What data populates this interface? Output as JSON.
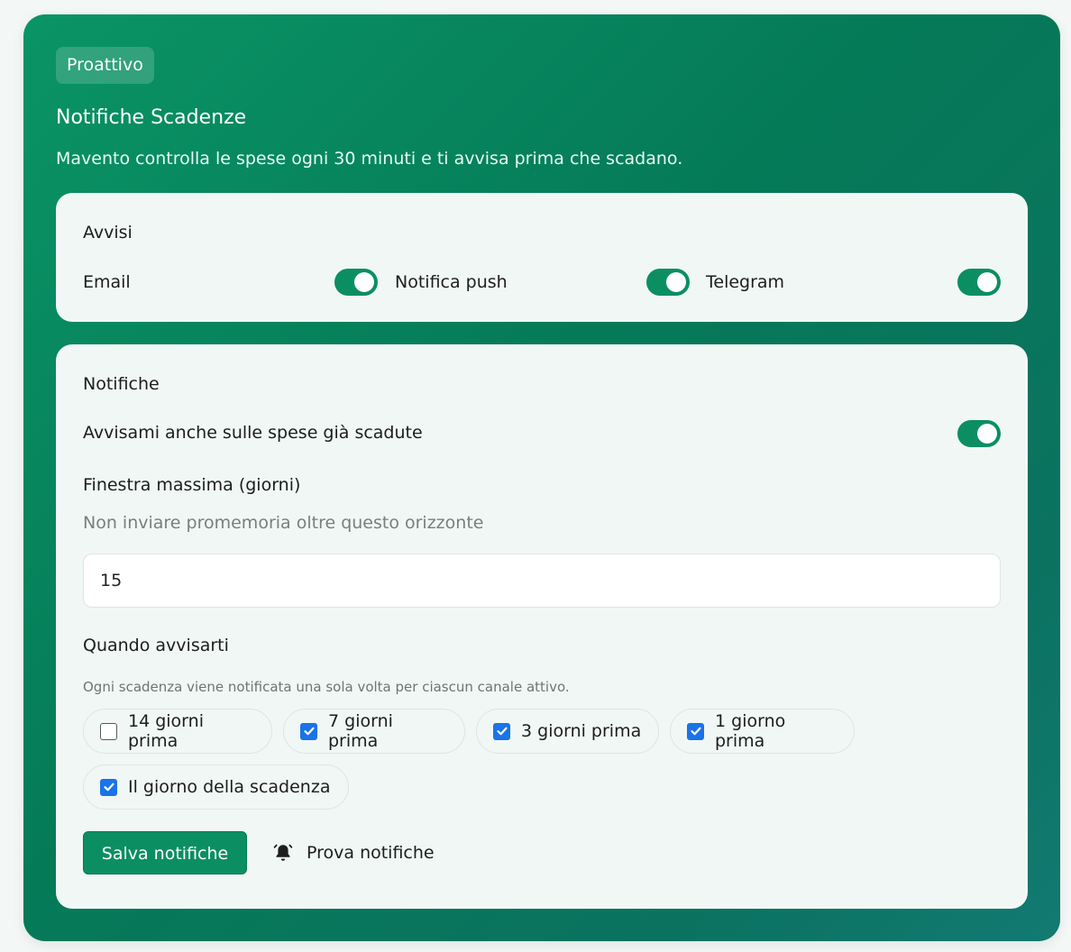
{
  "header": {
    "badge": "Proattivo",
    "title": "Notifiche Scadenze",
    "subtitle": "Mavento controlla le spese ogni 30 minuti e ti avvisa prima che scadano."
  },
  "avvisi": {
    "title": "Avvisi",
    "channels": [
      {
        "label": "Email",
        "enabled": true
      },
      {
        "label": "Notifica push",
        "enabled": true
      },
      {
        "label": "Telegram",
        "enabled": true
      }
    ]
  },
  "notifiche": {
    "title": "Notifiche",
    "overdue_label": "Avvisami anche sulle spese già scadute",
    "overdue_enabled": true,
    "window_label": "Finestra massima (giorni)",
    "window_hint": "Non inviare promemoria oltre questo orizzonte",
    "window_value": "15",
    "when_label": "Quando avvisarti",
    "when_hint": "Ogni scadenza viene notificata una sola volta per ciascun canale attivo.",
    "options": [
      {
        "label": "14 giorni prima",
        "checked": false
      },
      {
        "label": "7 giorni prima",
        "checked": true
      },
      {
        "label": "3 giorni prima",
        "checked": true
      },
      {
        "label": "1 giorno prima",
        "checked": true
      },
      {
        "label": "Il giorno della scadenza",
        "checked": true
      }
    ],
    "save_label": "Salva notifiche",
    "test_label": "Prova notifiche"
  },
  "colors": {
    "accent": "#0b8f62",
    "checkbox": "#1a73e8"
  }
}
